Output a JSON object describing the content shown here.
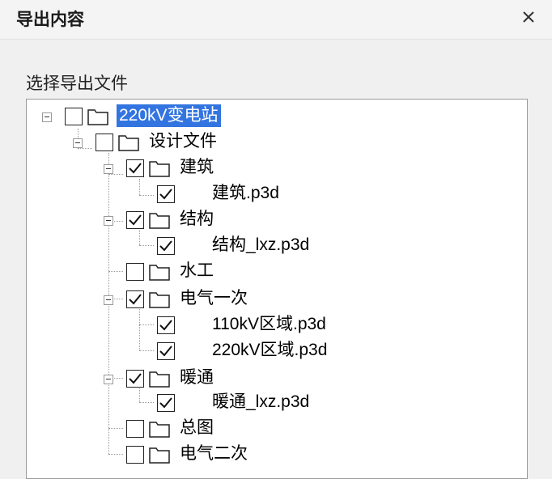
{
  "dialog": {
    "title": "导出内容",
    "close_icon": "close-icon"
  },
  "section": {
    "label": "选择导出文件"
  },
  "tree": {
    "root": {
      "label": "220kV变电站",
      "checked": false,
      "selected": true
    },
    "design": {
      "label": "设计文件",
      "checked": false
    },
    "items": [
      {
        "label": "建筑",
        "checked": true
      },
      {
        "label": "建筑.p3d",
        "checked": true
      },
      {
        "label": "结构",
        "checked": true
      },
      {
        "label": "结构_lxz.p3d",
        "checked": true
      },
      {
        "label": "水工",
        "checked": false
      },
      {
        "label": "电气一次",
        "checked": true
      },
      {
        "label": "110kV区域.p3d",
        "checked": true
      },
      {
        "label": "220kV区域.p3d",
        "checked": true
      },
      {
        "label": "暖通",
        "checked": true
      },
      {
        "label": "暖通_lxz.p3d",
        "checked": true
      },
      {
        "label": "总图",
        "checked": false
      },
      {
        "label": "电气二次",
        "checked": false
      }
    ]
  },
  "colors": {
    "selection": "#3375e0",
    "background": "#f0f0f0",
    "panel": "#ffffff"
  }
}
